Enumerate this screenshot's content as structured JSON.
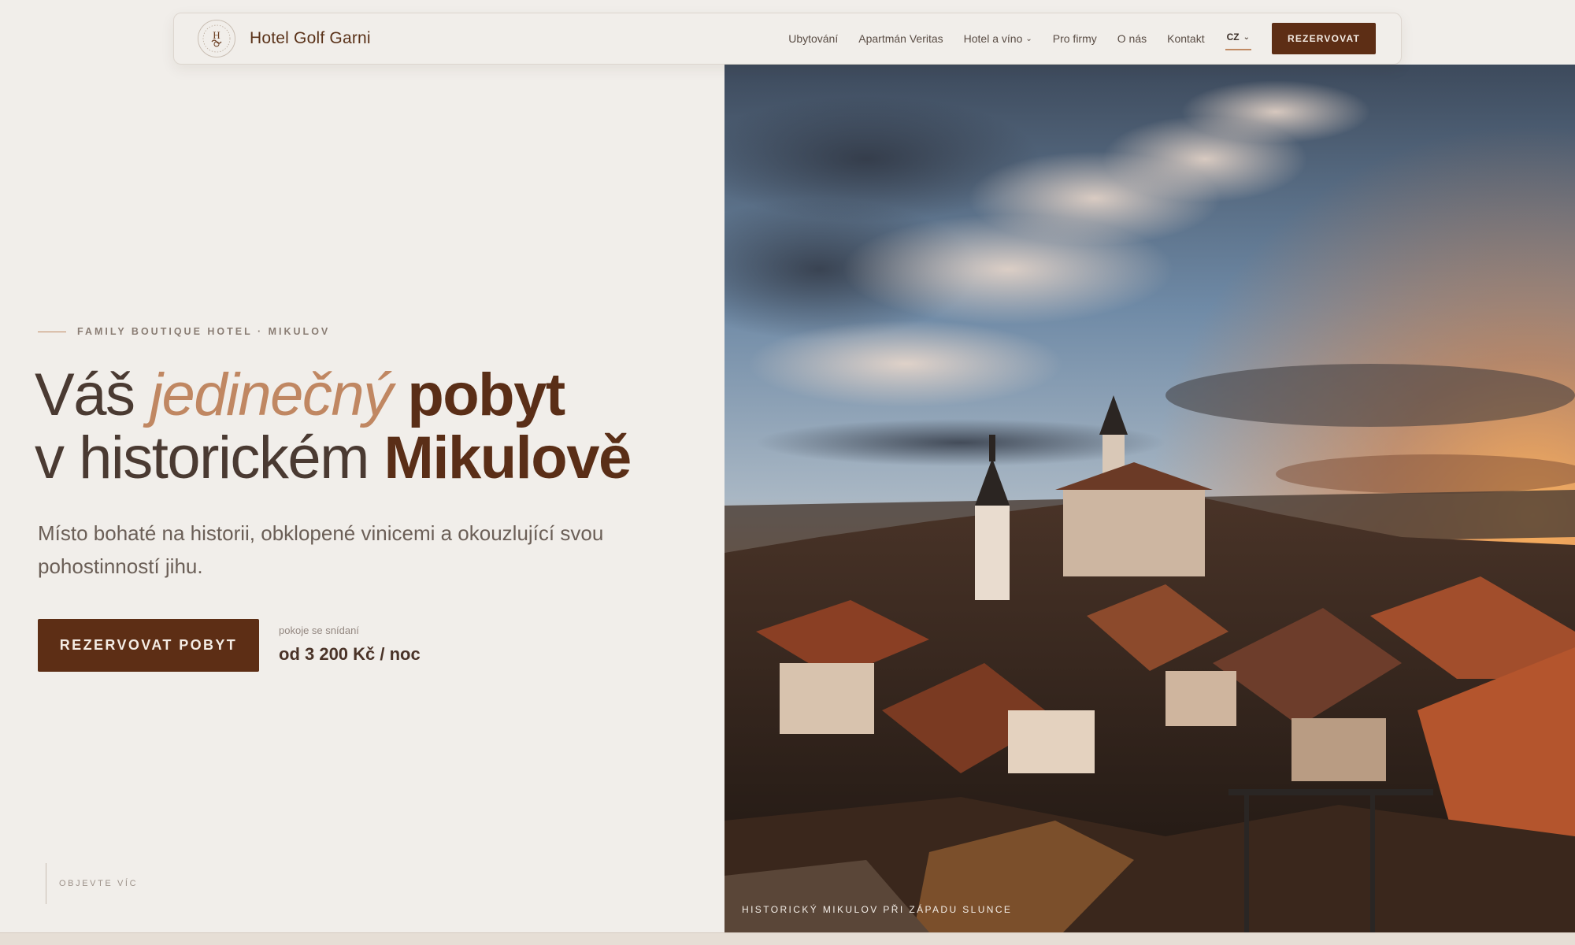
{
  "brand": {
    "name": "Hotel Golf Garni",
    "logo_letter": "H"
  },
  "nav": {
    "items": [
      {
        "label": "Ubytování",
        "has_dropdown": false
      },
      {
        "label": "Apartmán Veritas",
        "has_dropdown": false
      },
      {
        "label": "Hotel a víno",
        "has_dropdown": true
      },
      {
        "label": "Pro firmy",
        "has_dropdown": false
      },
      {
        "label": "O nás",
        "has_dropdown": false
      },
      {
        "label": "Kontakt",
        "has_dropdown": false
      }
    ],
    "language": "CZ",
    "cta_label": "REZERVOVAT"
  },
  "hero": {
    "eyebrow": "FAMILY BOUTIQUE HOTEL · MIKULOV",
    "headline": {
      "line1_a": "Váš",
      "line1_accent": "jedinečný",
      "line1_bold": "pobyt",
      "line2_a": "v historickém",
      "line2_bold": "Mikulově"
    },
    "subtitle": "Místo bohaté na historii, obklopené vinicemi a okouzlující svou pohostinností jihu.",
    "cta_label": "REZERVOVAT POBYT",
    "price_note": "pokoje se snídaní",
    "price_value": "od 3 200 Kč / noc",
    "explore_label": "OBJEVTE VÍC"
  },
  "photo": {
    "caption": "HISTORICKÝ MIKULOV PŘI ZÁPADU SLUNCE"
  },
  "colors": {
    "background": "#f1eeea",
    "brand_brown": "#5d2e15",
    "accent_copper": "#c08762",
    "text_dark": "#3a2a22"
  },
  "icons": {
    "logo": "hotel-crest-icon",
    "dropdown": "chevron-down-icon"
  }
}
